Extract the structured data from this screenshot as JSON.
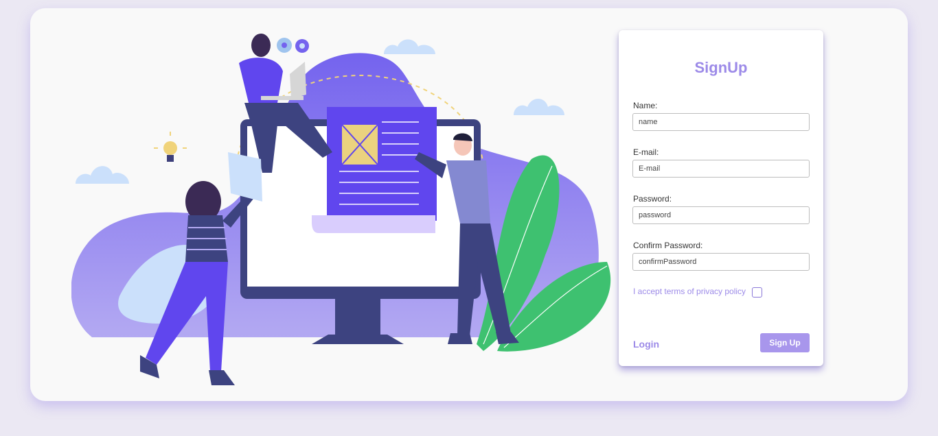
{
  "form": {
    "title": "SignUp",
    "name_label": "Name:",
    "name_placeholder": "name",
    "email_label": "E-mail:",
    "email_placeholder": "E-mail",
    "password_label": "Password:",
    "password_placeholder": "password",
    "confirm_label": "Confirm Password:",
    "confirm_placeholder": "confirmPassword",
    "terms_label": "I accept terms of privacy policy",
    "terms_checked": false,
    "login_label": "Login",
    "signup_label": "Sign Up"
  },
  "colors": {
    "accent": "#9c8ae8",
    "button": "#a896ec",
    "page_background": "#ebe8f3"
  }
}
